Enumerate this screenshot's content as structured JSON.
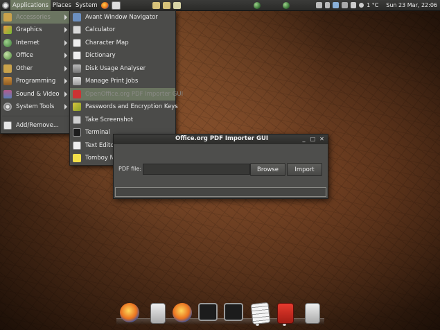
{
  "panel": {
    "menus": [
      "Applications",
      "Places",
      "System"
    ],
    "clock": "Sun 23 Mar, 22:06",
    "weather": "1 °C"
  },
  "categories": [
    {
      "label": "Accessories",
      "icon": "accessories-icon"
    },
    {
      "label": "Graphics",
      "icon": "graphics-icon"
    },
    {
      "label": "Internet",
      "icon": "internet-icon"
    },
    {
      "label": "Office",
      "icon": "office-icon"
    },
    {
      "label": "Other",
      "icon": "other-icon"
    },
    {
      "label": "Programming",
      "icon": "programming-icon"
    },
    {
      "label": "Sound & Video",
      "icon": "sound-video-icon"
    },
    {
      "label": "System Tools",
      "icon": "system-tools-icon"
    },
    {
      "label": "Add/Remove...",
      "icon": "add-remove-icon"
    }
  ],
  "accessories": [
    {
      "label": "Avant Window Navigator",
      "icon": "awn-icon"
    },
    {
      "label": "Calculator",
      "icon": "calculator-icon"
    },
    {
      "label": "Character Map",
      "icon": "character-map-icon"
    },
    {
      "label": "Dictionary",
      "icon": "dictionary-icon"
    },
    {
      "label": "Disk Usage Analyser",
      "icon": "disk-usage-icon"
    },
    {
      "label": "Manage Print Jobs",
      "icon": "printer-icon"
    },
    {
      "label": "OpenOffice.org PDF Importer GUI",
      "icon": "pdf-importer-icon"
    },
    {
      "label": "Passwords and Encryption Keys",
      "icon": "keys-icon"
    },
    {
      "label": "Take Screenshot",
      "icon": "screenshot-icon"
    },
    {
      "label": "Terminal",
      "icon": "terminal-icon"
    },
    {
      "label": "Text Editor",
      "icon": "text-editor-icon"
    },
    {
      "label": "Tomboy Notes",
      "icon": "tomboy-icon"
    }
  ],
  "dialog": {
    "title": "Office.org PDF Importer GUI",
    "pdf_label": "PDF file:",
    "pdf_value": "",
    "browse": "Browse",
    "import": "Import",
    "status": ""
  },
  "dock": [
    {
      "icon": "firefox-icon"
    },
    {
      "icon": "file-icon"
    },
    {
      "icon": "firefox-icon"
    },
    {
      "icon": "terminal-icon"
    },
    {
      "icon": "terminal-icon"
    },
    {
      "icon": "text-editor-icon"
    },
    {
      "icon": "pdf-icon"
    },
    {
      "icon": "file-icon"
    }
  ],
  "colors": {
    "menu_bg": "#4b4b49",
    "menu_selected": "#6b7561",
    "panel_bg": "#2f2f2d"
  }
}
